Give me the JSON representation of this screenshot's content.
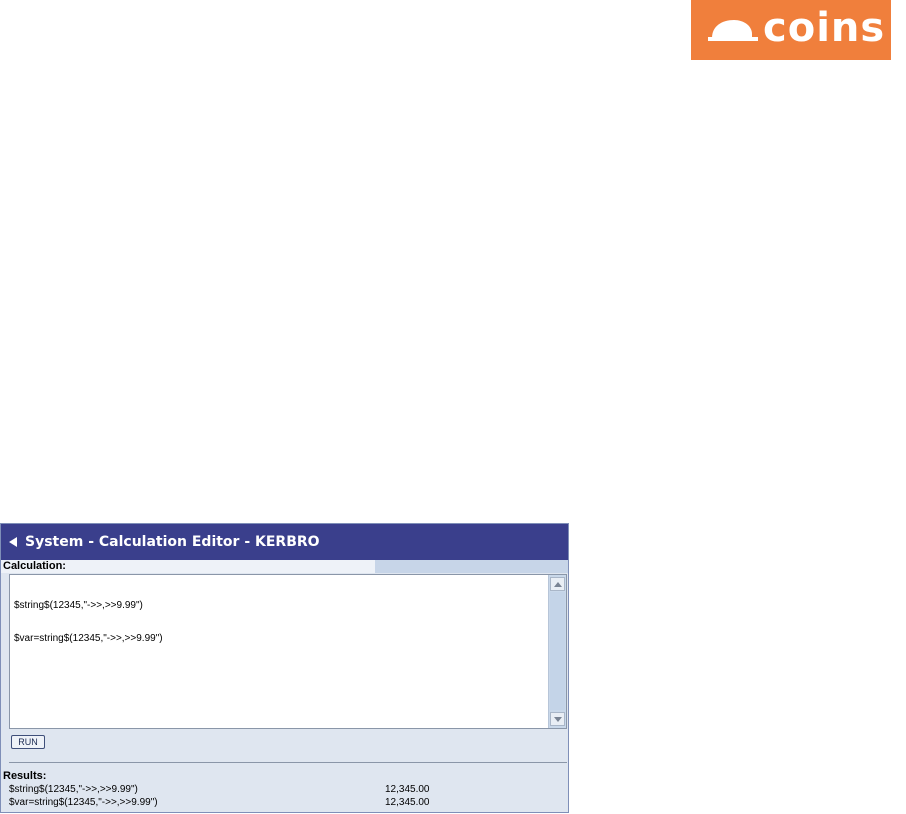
{
  "logo": {
    "text": "coins",
    "colors": {
      "background": "#f07f3c",
      "foreground": "#ffffff"
    },
    "icon": "hard-hat-icon"
  },
  "window": {
    "title": "System - Calculation Editor - KERBRO",
    "back_icon": "back-arrow-icon",
    "colors": {
      "titlebar": "#3a3f8c",
      "panel": "#dfe6f0"
    }
  },
  "calculation": {
    "label": "Calculation:",
    "lines": [
      "$string$(12345,\"->>,>>9.99\")",
      "$var=string$(12345,\"->>,>>9.99\")"
    ]
  },
  "run_button": {
    "label": "RUN"
  },
  "results": {
    "label": "Results:",
    "rows": [
      {
        "expression": "$string$(12345,\"->>,>>9.99\")",
        "value": "12,345.00"
      },
      {
        "expression": "$var=string$(12345,\"->>,>>9.99\")",
        "value": "12,345.00"
      }
    ]
  }
}
